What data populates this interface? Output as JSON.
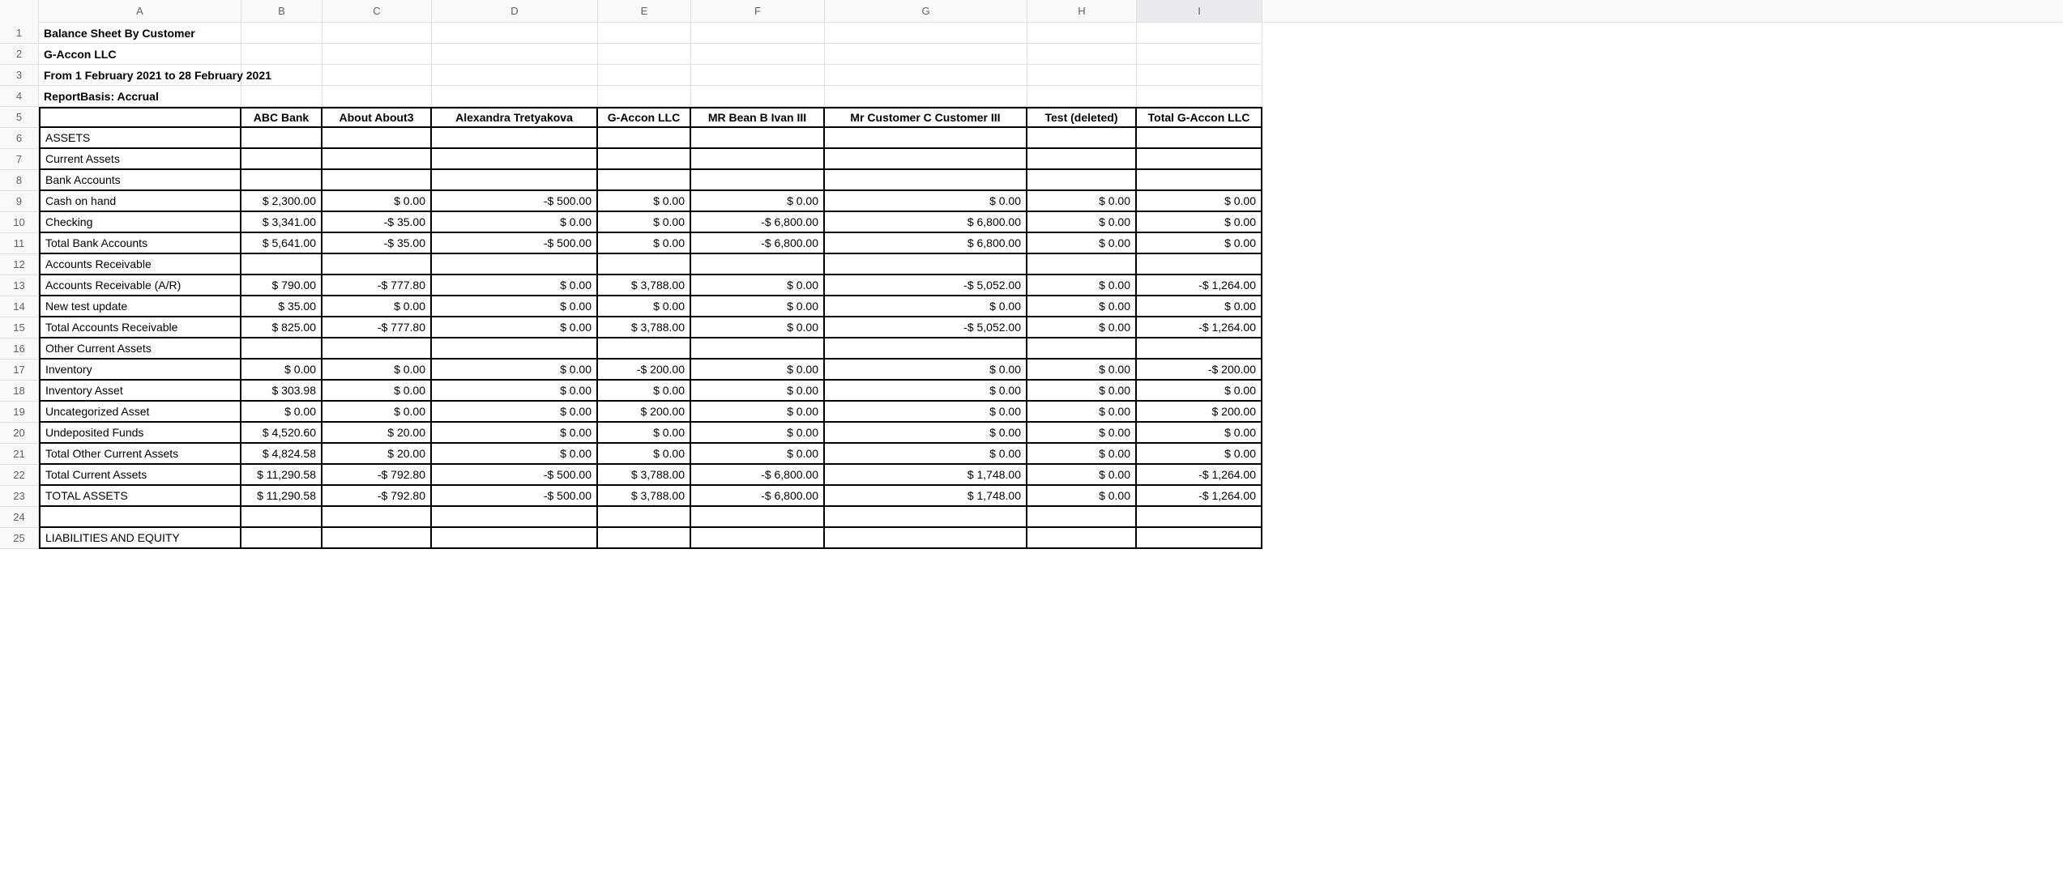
{
  "columns": [
    "A",
    "B",
    "C",
    "D",
    "E",
    "F",
    "G",
    "H",
    "I"
  ],
  "rowNumbers": [
    "1",
    "2",
    "3",
    "4",
    "5",
    "6",
    "7",
    "8",
    "9",
    "10",
    "11",
    "12",
    "13",
    "14",
    "15",
    "16",
    "17",
    "18",
    "19",
    "20",
    "21",
    "22",
    "23",
    "24",
    "25"
  ],
  "headers": {
    "title": "Balance Sheet By Customer",
    "company": "G-Accon LLC",
    "period": "From 1 February 2021 to 28 February 2021",
    "basis": "ReportBasis: Accrual"
  },
  "colHeaders": [
    "ABC Bank",
    "About About3",
    "Alexandra Tretyakova",
    "G-Accon LLC",
    "MR Bean B Ivan III",
    "Mr Customer C Customer III",
    "Test (deleted)",
    "Total G-Accon LLC"
  ],
  "rows": {
    "assets": "ASSETS",
    "currentAssets": "Current Assets",
    "bankAccounts": "Bank Accounts",
    "cashOnHand": {
      "label": "Cash on hand",
      "vals": [
        "$ 2,300.00",
        "$ 0.00",
        "-$ 500.00",
        "$ 0.00",
        "$ 0.00",
        "$ 0.00",
        "$ 0.00",
        "$ 0.00"
      ]
    },
    "checking": {
      "label": "Checking",
      "vals": [
        "$ 3,341.00",
        "-$ 35.00",
        "$ 0.00",
        "$ 0.00",
        "-$ 6,800.00",
        "$ 6,800.00",
        "$ 0.00",
        "$ 0.00"
      ]
    },
    "totalBank": {
      "label": "Total Bank Accounts",
      "vals": [
        "$ 5,641.00",
        "-$ 35.00",
        "-$ 500.00",
        "$ 0.00",
        "-$ 6,800.00",
        "$ 6,800.00",
        "$ 0.00",
        "$ 0.00"
      ]
    },
    "accRecv": "Accounts Receivable",
    "accRecvAR": {
      "label": "Accounts Receivable (A/R)",
      "vals": [
        "$ 790.00",
        "-$ 777.80",
        "$ 0.00",
        "$ 3,788.00",
        "$ 0.00",
        "-$ 5,052.00",
        "$ 0.00",
        "-$ 1,264.00"
      ]
    },
    "newTest": {
      "label": "New test update",
      "vals": [
        "$ 35.00",
        "$ 0.00",
        "$ 0.00",
        "$ 0.00",
        "$ 0.00",
        "$ 0.00",
        "$ 0.00",
        "$ 0.00"
      ]
    },
    "totalAccRecv": {
      "label": "Total Accounts Receivable",
      "vals": [
        "$ 825.00",
        "-$ 777.80",
        "$ 0.00",
        "$ 3,788.00",
        "$ 0.00",
        "-$ 5,052.00",
        "$ 0.00",
        "-$ 1,264.00"
      ]
    },
    "otherCurrent": "Other Current Assets",
    "inventory": {
      "label": "Inventory",
      "vals": [
        "$ 0.00",
        "$ 0.00",
        "$ 0.00",
        "-$ 200.00",
        "$ 0.00",
        "$ 0.00",
        "$ 0.00",
        "-$ 200.00"
      ]
    },
    "inventoryAsset": {
      "label": "Inventory Asset",
      "vals": [
        "$ 303.98",
        "$ 0.00",
        "$ 0.00",
        "$ 0.00",
        "$ 0.00",
        "$ 0.00",
        "$ 0.00",
        "$ 0.00"
      ]
    },
    "uncatAsset": {
      "label": "Uncategorized Asset",
      "vals": [
        "$ 0.00",
        "$ 0.00",
        "$ 0.00",
        "$ 200.00",
        "$ 0.00",
        "$ 0.00",
        "$ 0.00",
        "$ 200.00"
      ]
    },
    "undeposited": {
      "label": "Undeposited Funds",
      "vals": [
        "$ 4,520.60",
        "$ 20.00",
        "$ 0.00",
        "$ 0.00",
        "$ 0.00",
        "$ 0.00",
        "$ 0.00",
        "$ 0.00"
      ]
    },
    "totalOther": {
      "label": "Total Other Current Assets",
      "vals": [
        "$ 4,824.58",
        "$ 20.00",
        "$ 0.00",
        "$ 0.00",
        "$ 0.00",
        "$ 0.00",
        "$ 0.00",
        "$ 0.00"
      ]
    },
    "totalCurrent": {
      "label": "Total Current Assets",
      "vals": [
        "$ 11,290.58",
        "-$ 792.80",
        "-$ 500.00",
        "$ 3,788.00",
        "-$ 6,800.00",
        "$ 1,748.00",
        "$ 0.00",
        "-$ 1,264.00"
      ]
    },
    "totalAssets": {
      "label": "TOTAL ASSETS",
      "vals": [
        "$ 11,290.58",
        "-$ 792.80",
        "-$ 500.00",
        "$ 3,788.00",
        "-$ 6,800.00",
        "$ 1,748.00",
        "$ 0.00",
        "-$ 1,264.00"
      ]
    },
    "liabilities": "LIABILITIES AND EQUITY"
  }
}
